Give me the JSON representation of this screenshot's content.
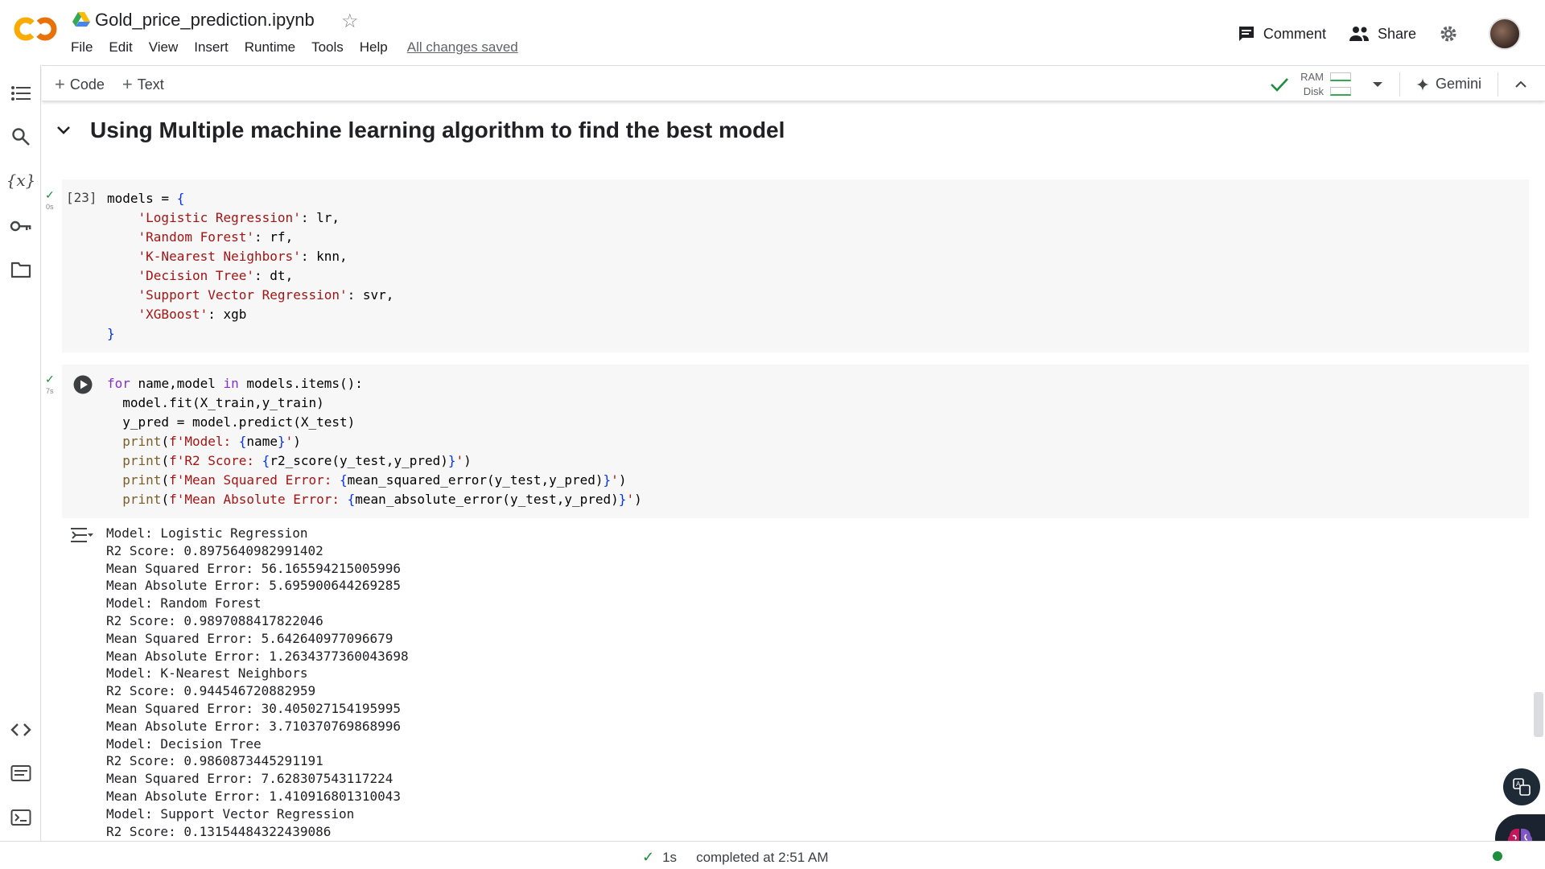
{
  "header": {
    "notebook_title": "Gold_price_prediction.ipynb",
    "menu": [
      "File",
      "Edit",
      "View",
      "Insert",
      "Runtime",
      "Tools",
      "Help"
    ],
    "save_status": "All changes saved",
    "comment_label": "Comment",
    "share_label": "Share",
    "logo_text": "CO"
  },
  "toolbar": {
    "code_label": "Code",
    "text_label": "Text",
    "ram_label": "RAM",
    "disk_label": "Disk",
    "gemini_label": "Gemini"
  },
  "section": {
    "title": "Using Multiple machine learning algorithm to find the best model"
  },
  "cell1": {
    "exec_count": "[23]",
    "time": "0s"
  },
  "cell2": {
    "time": "7s"
  },
  "output_lines": [
    "Model: Logistic Regression",
    "R2 Score: 0.8975640982991402",
    "Mean Squared Error: 56.165594215005996",
    "Mean Absolute Error: 5.695900644269285",
    "Model: Random Forest",
    "R2 Score: 0.9897088417822046",
    "Mean Squared Error: 5.642640977096679",
    "Mean Absolute Error: 1.2634377360043698",
    "Model: K-Nearest Neighbors",
    "R2 Score: 0.944546720882959",
    "Mean Squared Error: 30.405027154195995",
    "Mean Absolute Error: 3.710370769868996",
    "Model: Decision Tree",
    "R2 Score: 0.9860873445291191",
    "Mean Squared Error: 7.628307543117224",
    "Mean Absolute Error: 1.410916801310043",
    "Model: Support Vector Regression",
    "R2 Score: 0.13154484322439086"
  ],
  "status": {
    "duration": "1s",
    "completed": "completed at 2:51 AM"
  },
  "colors": {
    "accent_orange": "#f9ab00",
    "success_green": "#1e8e3e",
    "keyword_purple": "#8430ce",
    "string_red": "#a31515"
  }
}
